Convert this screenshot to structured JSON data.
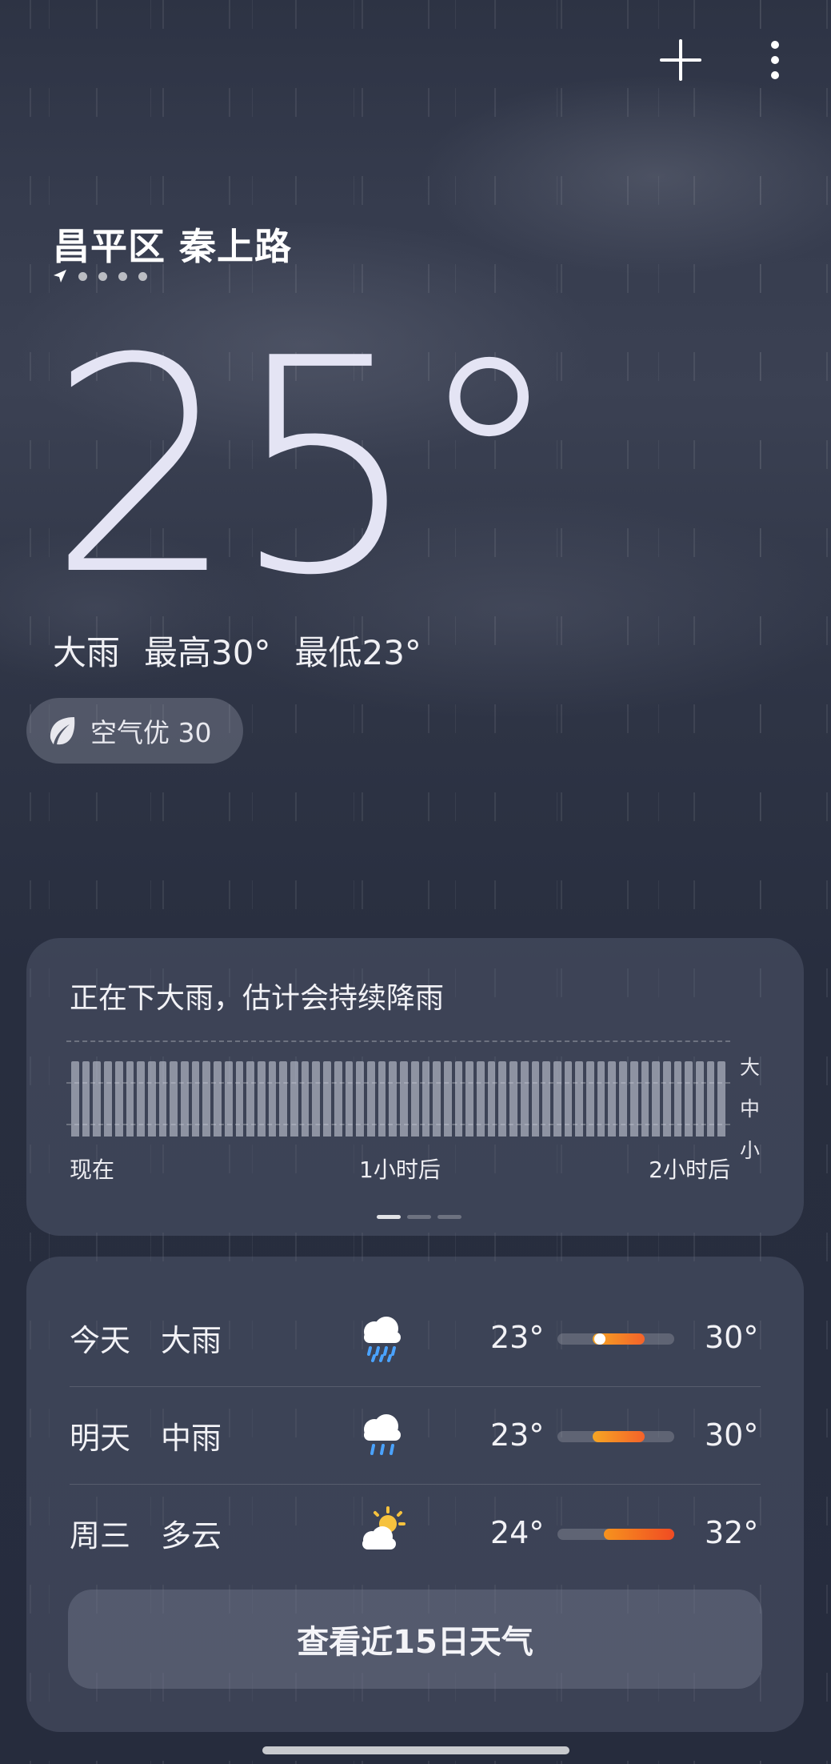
{
  "header": {
    "location": "昌平区 秦上路"
  },
  "current": {
    "temperature": "25°",
    "condition": "大雨",
    "high": "最高30°",
    "low": "最低23°",
    "air_quality": "空气优 30"
  },
  "rain_card": {
    "title": "正在下大雨，估计会持续降雨",
    "levels": [
      "大",
      "中",
      "小"
    ],
    "timeline": [
      "现在",
      "1小时后",
      "2小时后"
    ],
    "intensity_fraction": 0.78
  },
  "forecast": {
    "days": [
      {
        "day": "今天",
        "condition": "大雨",
        "icon": "heavy-rain-icon",
        "low": "23°",
        "high": "30°",
        "range_start": 0.3,
        "range_end": 0.75,
        "current": 0.36,
        "color_start": "#f6a623",
        "color_end": "#f4622a"
      },
      {
        "day": "明天",
        "condition": "中雨",
        "icon": "moderate-rain-icon",
        "low": "23°",
        "high": "30°",
        "range_start": 0.3,
        "range_end": 0.75,
        "color_start": "#f6a623",
        "color_end": "#f4622a"
      },
      {
        "day": "周三",
        "condition": "多云",
        "icon": "partly-cloudy-icon",
        "low": "24°",
        "high": "32°",
        "range_start": 0.4,
        "range_end": 1.0,
        "color_start": "#f7931e",
        "color_end": "#f04b23"
      }
    ],
    "more_button": "查看近15日天气"
  }
}
